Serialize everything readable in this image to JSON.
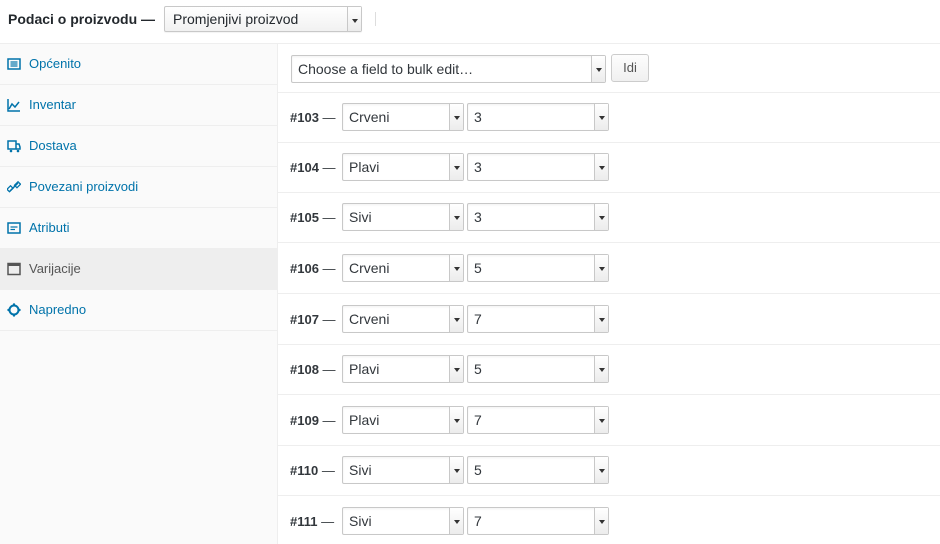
{
  "header": {
    "title": "Podaci o proizvodu —",
    "product_type": "Promjenjivi proizvod"
  },
  "sidebar": {
    "items": [
      {
        "label": "Općenito",
        "icon": "general-icon",
        "active": false
      },
      {
        "label": "Inventar",
        "icon": "inventory-icon",
        "active": false
      },
      {
        "label": "Dostava",
        "icon": "shipping-icon",
        "active": false
      },
      {
        "label": "Povezani proizvodi",
        "icon": "linked-products-icon",
        "active": false
      },
      {
        "label": "Atributi",
        "icon": "attributes-icon",
        "active": false
      },
      {
        "label": "Varijacije",
        "icon": "variations-icon",
        "active": true
      },
      {
        "label": "Napredno",
        "icon": "advanced-icon",
        "active": false
      }
    ]
  },
  "bulk": {
    "placeholder": "Choose a field to bulk edit…",
    "go_label": "Idi"
  },
  "variations": [
    {
      "id": "#103",
      "color": "Crveni",
      "size": "3"
    },
    {
      "id": "#104",
      "color": "Plavi",
      "size": "3"
    },
    {
      "id": "#105",
      "color": "Sivi",
      "size": "3"
    },
    {
      "id": "#106",
      "color": "Crveni",
      "size": "5"
    },
    {
      "id": "#107",
      "color": "Crveni",
      "size": "7"
    },
    {
      "id": "#108",
      "color": "Plavi",
      "size": "5"
    },
    {
      "id": "#109",
      "color": "Plavi",
      "size": "7"
    },
    {
      "id": "#110",
      "color": "Sivi",
      "size": "5"
    },
    {
      "id": "#111",
      "color": "Sivi",
      "size": "7"
    }
  ],
  "colors": {
    "link": "#0073aa",
    "active_bg": "#eeeeee",
    "sidebar_bg": "#fafafa"
  }
}
